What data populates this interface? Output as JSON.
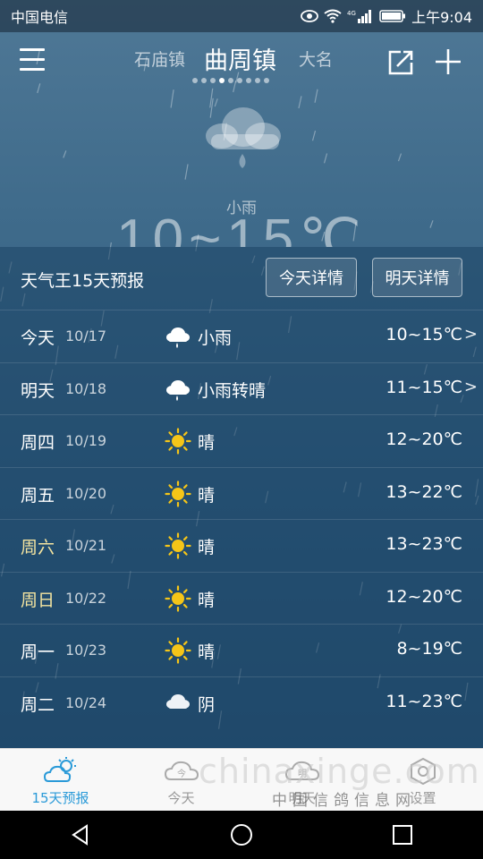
{
  "status_bar": {
    "carrier": "中国电信",
    "time": "上午9:04",
    "icons": [
      "eye-icon",
      "wifi-icon",
      "signal-4g-icon",
      "battery-icon"
    ]
  },
  "header": {
    "city_prev": "石庙镇",
    "city_current": "曲周镇",
    "city_next": "大名",
    "page_count": 9,
    "active_page": 3
  },
  "current": {
    "condition": "小雨",
    "temperature": "10~15℃"
  },
  "forecast": {
    "title": "天气王15天预报",
    "btn_today": "今天详情",
    "btn_tomorrow": "明天详情",
    "days": [
      {
        "day": "今天",
        "date": "10/17",
        "icon": "cloud-rain-icon",
        "condition": "小雨",
        "temp": "10~15℃",
        "chevron": true,
        "weekend": false
      },
      {
        "day": "明天",
        "date": "10/18",
        "icon": "cloud-rain-icon",
        "condition": "小雨转晴",
        "temp": "11~15℃",
        "chevron": true,
        "weekend": false
      },
      {
        "day": "周四",
        "date": "10/19",
        "icon": "sun-icon",
        "condition": "晴",
        "temp": "12~20℃",
        "chevron": false,
        "weekend": false
      },
      {
        "day": "周五",
        "date": "10/20",
        "icon": "sun-icon",
        "condition": "晴",
        "temp": "13~22℃",
        "chevron": false,
        "weekend": false
      },
      {
        "day": "周六",
        "date": "10/21",
        "icon": "sun-icon",
        "condition": "晴",
        "temp": "13~23℃",
        "chevron": false,
        "weekend": true
      },
      {
        "day": "周日",
        "date": "10/22",
        "icon": "sun-icon",
        "condition": "晴",
        "temp": "12~20℃",
        "chevron": false,
        "weekend": true
      },
      {
        "day": "周一",
        "date": "10/23",
        "icon": "sun-icon",
        "condition": "晴",
        "temp": "8~19℃",
        "chevron": false,
        "weekend": false
      },
      {
        "day": "周二",
        "date": "10/24",
        "icon": "cloud-icon",
        "condition": "阴",
        "temp": "11~23℃",
        "chevron": false,
        "weekend": false
      }
    ]
  },
  "tabs": [
    {
      "label": "15天预报",
      "icon": "sun-cloud-icon",
      "active": true
    },
    {
      "label": "今天",
      "icon": "cloud-today-icon",
      "active": false
    },
    {
      "label": "明天",
      "icon": "cloud-tomorrow-icon",
      "active": false
    },
    {
      "label": "设置",
      "icon": "settings-icon",
      "active": false
    }
  ],
  "watermark": {
    "text": "chinaxinge.com",
    "subtext": "中国信鸽信息网"
  },
  "colors": {
    "accent": "#2a9ad8",
    "weekend": "#f4e4a0",
    "sun": "#f5c518"
  }
}
